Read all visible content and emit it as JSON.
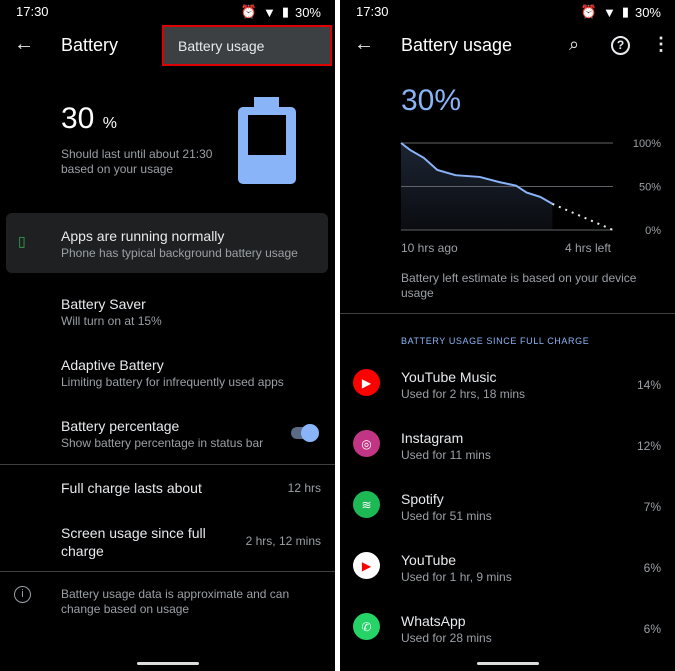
{
  "status": {
    "time": "17:30",
    "battery": "30%"
  },
  "left": {
    "title": "Battery",
    "menu_popup": "Battery usage",
    "level": "30",
    "level_unit": "%",
    "estimate": "Should last until about 21:30 based on your usage",
    "card": {
      "title": "Apps are running normally",
      "subtitle": "Phone has typical background battery usage"
    },
    "items": [
      {
        "title": "Battery Saver",
        "subtitle": "Will turn on at 15%"
      },
      {
        "title": "Adaptive Battery",
        "subtitle": "Limiting battery for infrequently used apps"
      },
      {
        "title": "Battery percentage",
        "subtitle": "Show battery percentage in status bar",
        "toggle": true
      }
    ],
    "stats": [
      {
        "label": "Full charge lasts about",
        "value": "12 hrs"
      },
      {
        "label": "Screen usage since full charge",
        "value": "2 hrs, 12 mins"
      }
    ],
    "footer": "Battery usage data is approximate and can change based on usage"
  },
  "right": {
    "title": "Battery usage",
    "level": "30%",
    "estimate_note": "Battery left estimate is based on your device usage",
    "section_header": "BATTERY USAGE SINCE FULL CHARGE",
    "apps": [
      {
        "name": "YouTube Music",
        "usage": "Used for 2 hrs, 18 mins",
        "percent": "14%",
        "color": "#ff0000",
        "icon": "youtube-music-icon"
      },
      {
        "name": "Instagram",
        "usage": "Used for 11 mins",
        "percent": "12%",
        "color": "#c13584",
        "icon": "instagram-icon"
      },
      {
        "name": "Spotify",
        "usage": "Used for 51 mins",
        "percent": "7%",
        "color": "#1db954",
        "icon": "spotify-icon"
      },
      {
        "name": "YouTube",
        "usage": "Used for 1 hr, 9 mins",
        "percent": "6%",
        "color": "#ffffff",
        "icon": "youtube-icon"
      },
      {
        "name": "WhatsApp",
        "usage": "Used for 28 mins",
        "percent": "6%",
        "color": "#25d366",
        "icon": "whatsapp-icon"
      }
    ]
  },
  "chart_data": {
    "type": "line",
    "x_start_label": "10 hrs ago",
    "x_end_label": "4 hrs left",
    "xlim": [
      -10,
      4
    ],
    "ylim": [
      0,
      100
    ],
    "y_ticks": [
      "100%",
      "50%",
      "0%"
    ],
    "grid": true,
    "accent": "#8ab4f8",
    "history": {
      "x": [
        -10,
        -9.4,
        -8.5,
        -7.6,
        -6.4,
        -4.8,
        -3.5,
        -2.4,
        -1.7,
        -0.8,
        0
      ],
      "y": [
        100,
        92,
        83,
        69,
        63,
        61,
        55,
        51,
        43,
        38,
        30
      ]
    },
    "projection": {
      "x": [
        0,
        4
      ],
      "y": [
        30,
        0
      ]
    }
  }
}
